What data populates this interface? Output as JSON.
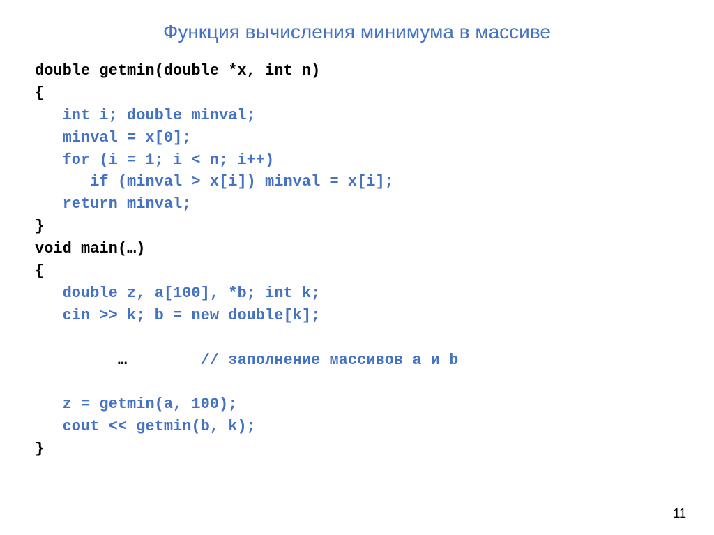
{
  "slide": {
    "title": "Функция вычисления минимума в массиве",
    "page_number": "11",
    "code_lines": [
      {
        "id": "line1",
        "text": "double getmin(double *x, int n)",
        "color": "black"
      },
      {
        "id": "line2",
        "text": "{",
        "color": "black"
      },
      {
        "id": "line3",
        "text": "   int i; double minval;",
        "color": "blue"
      },
      {
        "id": "line4",
        "text": "   minval = x[0];",
        "color": "blue"
      },
      {
        "id": "line5",
        "text": "   for (i = 1; i < n; i++)",
        "color": "blue"
      },
      {
        "id": "line6",
        "text": "      if (minval > x[i]) minval = x[i];",
        "color": "blue"
      },
      {
        "id": "line7",
        "text": "   return minval;",
        "color": "blue"
      },
      {
        "id": "line8",
        "text": "}",
        "color": "black"
      },
      {
        "id": "line9",
        "text": "void main(…)",
        "color": "black"
      },
      {
        "id": "line10",
        "text": "{",
        "color": "black"
      },
      {
        "id": "line11",
        "text": "   double z, a[100], *b; int k;",
        "color": "blue"
      },
      {
        "id": "line12",
        "text": "   cin >> k; b = new double[k];",
        "color": "blue"
      },
      {
        "id": "line13_black",
        "text": "   …",
        "color": "black"
      },
      {
        "id": "line13_comment",
        "text": "        // заполнение массивов a и b",
        "color": "blue"
      },
      {
        "id": "line14",
        "text": "   z = getmin(a, 100);",
        "color": "blue"
      },
      {
        "id": "line15",
        "text": "   cout << getmin(b, k);",
        "color": "blue"
      },
      {
        "id": "line16",
        "text": "}",
        "color": "black"
      }
    ]
  }
}
